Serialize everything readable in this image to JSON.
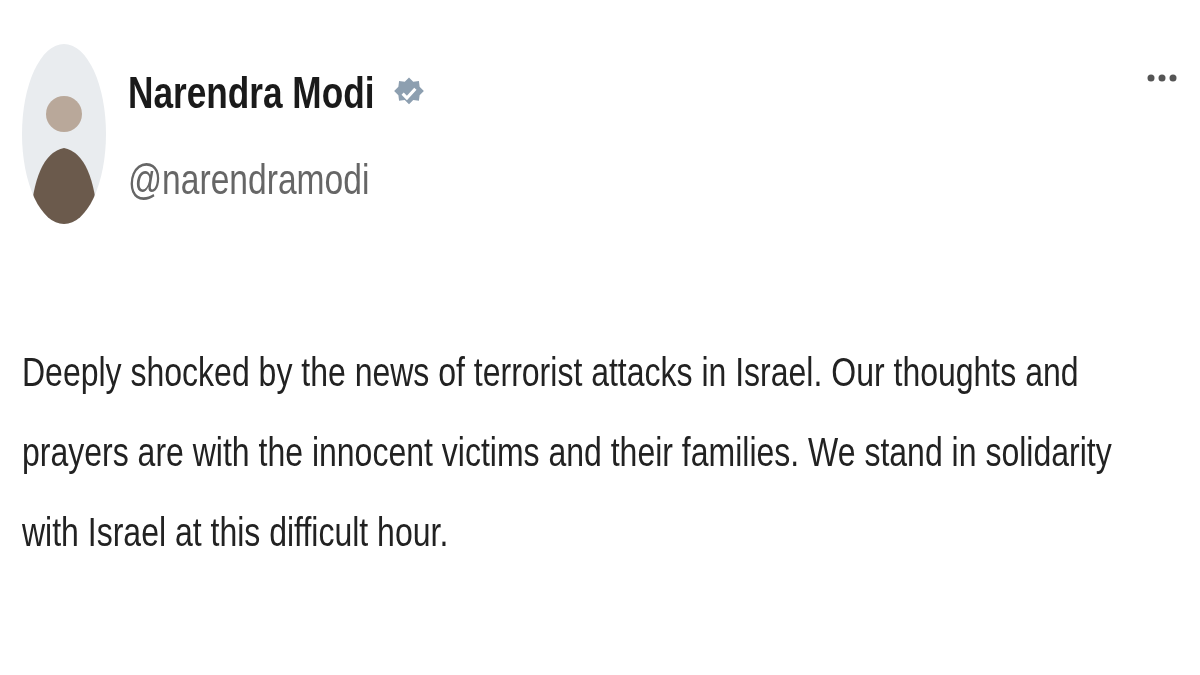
{
  "post": {
    "author": {
      "name": "Narendra Modi",
      "verified": true,
      "handle": "@narendramodi"
    },
    "text": "Deeply shocked by the news of terrorist attacks in Israel. Our thoughts and prayers are with the innocent victims and their families. We stand in solidarity with Israel at this difficult hour."
  }
}
